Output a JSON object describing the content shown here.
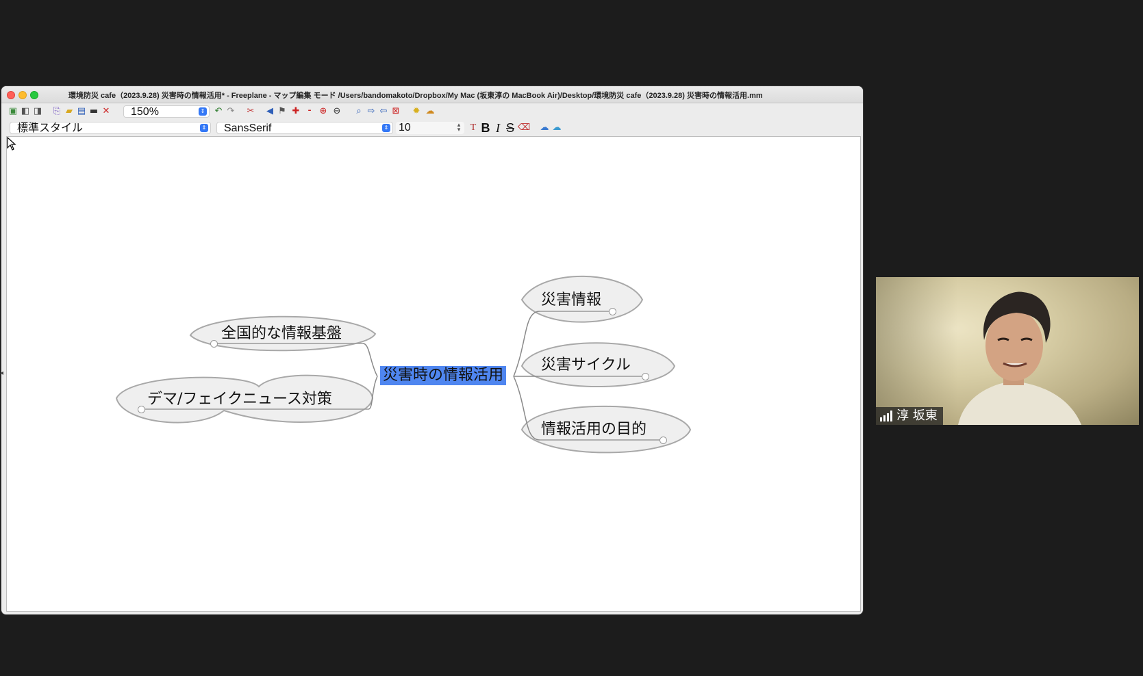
{
  "window": {
    "title": "環境防災 cafe（2023.9.28) 災害時の情報活用* - Freeplane - マップ編集 モード /Users/bandomakoto/Dropbox/My Mac (坂東淳の MacBook Air)/Desktop/環境防災 cafe（2023.9.28) 災害時の情報活用.mm"
  },
  "toolbar": {
    "zoom_value": "150%",
    "style_value": "標準スタイル",
    "font_value": "SansSerif",
    "font_size_value": "10",
    "bold_label": "B",
    "italic_label": "I",
    "strike_label": "S"
  },
  "mindmap": {
    "root": "災害時の情報活用",
    "left_nodes": [
      "全国的な情報基盤",
      "デマ/フェイクニュース対策"
    ],
    "right_nodes": [
      "災害情報",
      "災害サイクル",
      "情報活用の目的"
    ]
  },
  "video": {
    "participant_name": "淳 坂東"
  },
  "colors": {
    "root_highlight": "#4f86f0",
    "bubble_fill": "#efefef",
    "bubble_stroke": "#a8a8a8",
    "edge": "#8a8a8a"
  }
}
